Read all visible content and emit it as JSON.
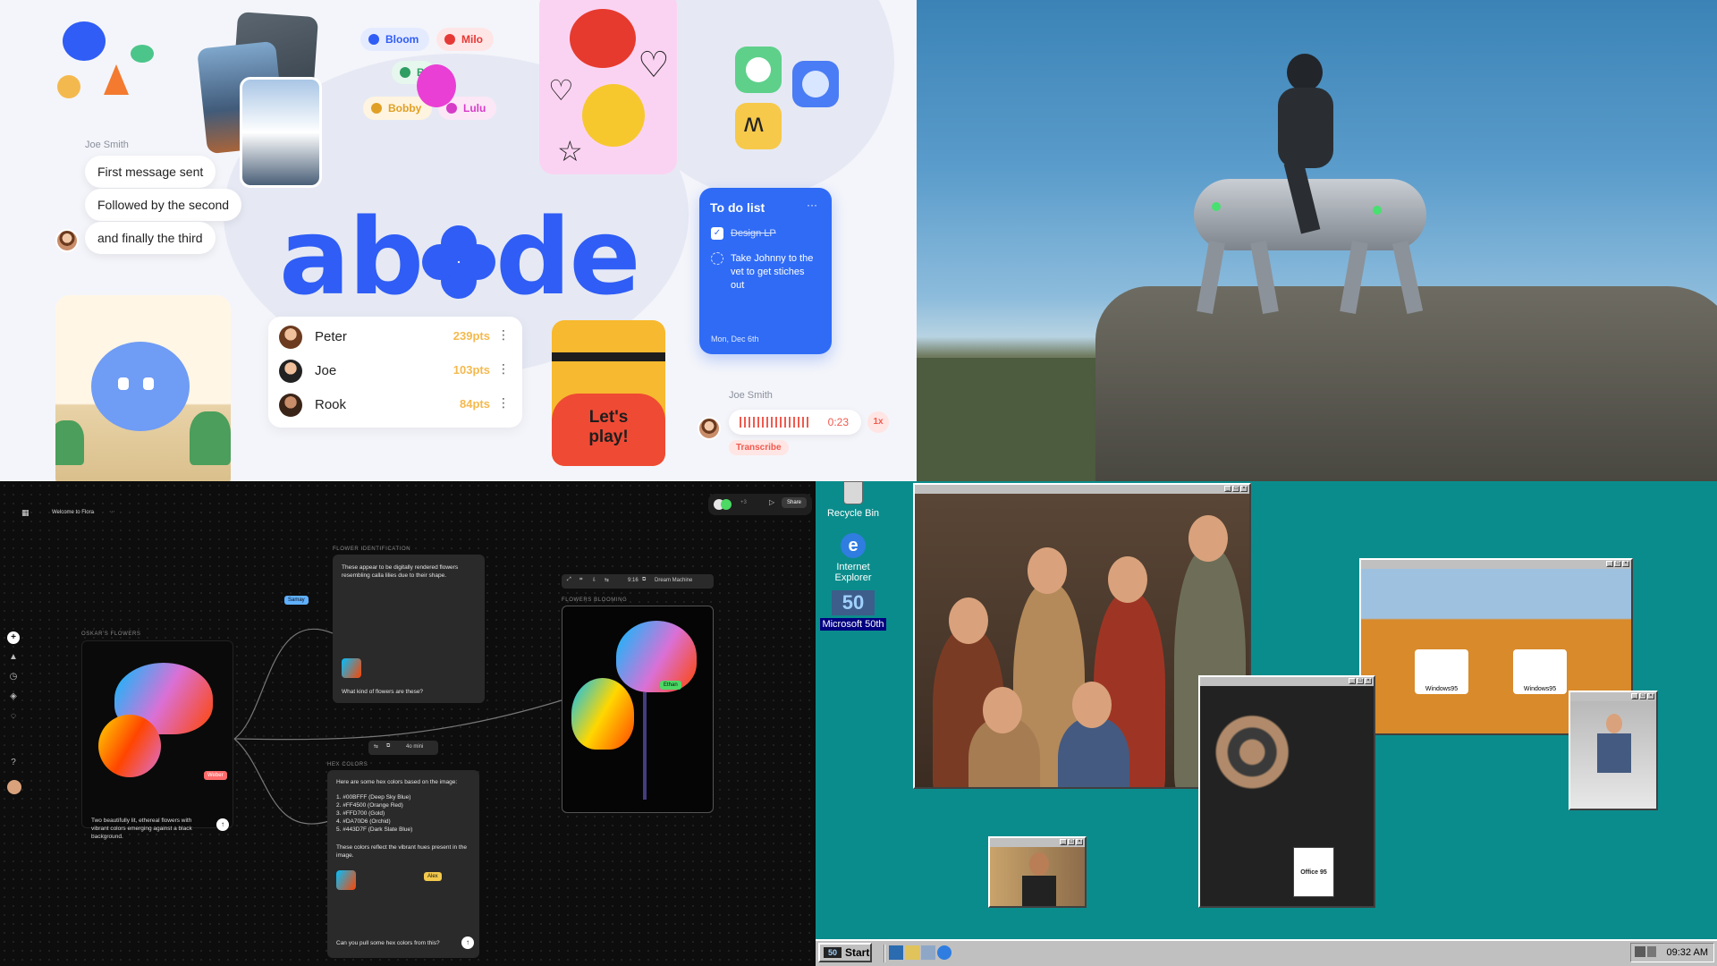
{
  "abode": {
    "logo": "abode",
    "chat": {
      "sender": "Joe Smith",
      "messages": [
        "First message sent",
        "Followed by the second",
        "and finally the third"
      ]
    },
    "tags": [
      "Bloom",
      "Milo",
      "B",
      "Bobby",
      "Lulu"
    ],
    "leaderboard": [
      {
        "name": "Peter",
        "points": "239pts"
      },
      {
        "name": "Joe",
        "points": "103pts"
      },
      {
        "name": "Rook",
        "points": "84pts"
      }
    ],
    "game_card": {
      "text_line1": "Let's",
      "text_line2": "play!"
    },
    "todo": {
      "title": "To do list",
      "menu": "···",
      "items": [
        {
          "text": "Design LP",
          "done": true
        },
        {
          "text": "Take Johnny to the vet to get stiches out",
          "done": false
        }
      ],
      "date": "Mon, Dec 6th"
    },
    "voice": {
      "sender": "Joe Smith",
      "duration": "0:23",
      "speed": "1x",
      "transcribe": "Transcribe"
    },
    "colors": {
      "brand": "#2f5df5",
      "points": "#f4b94e",
      "voice": "#f05a4f"
    }
  },
  "flora": {
    "window_title": "Welcome to Flora",
    "share_label": "Share",
    "avatar_count": "+3",
    "nodes": {
      "left_label": "OSKAR'S FLOWERS",
      "left_caption": "Two beautifully lit, ethereal flowers with vibrant colors emerging against a black background.",
      "ident_label": "FLOWER IDENTIFICATION",
      "ident_text": "These appear to be digitally rendered flowers resembling calla lilies due to their shape.",
      "ident_prompt": "What kind of flowers are these?",
      "hex_label": "HEX COLORS",
      "hex_intro": "Here are some hex colors based on the image:",
      "hex_list": [
        "1. #00BFFF (Deep Sky Blue)",
        "2. #FF4500 (Orange Red)",
        "3. #FFD700 (Gold)",
        "4. #DA70D6 (Orchid)",
        "5. #443D7F (Dark Slate Blue)"
      ],
      "hex_outro": "These colors reflect the vibrant hues present in the image.",
      "hex_prompt": "Can you pull some hex colors from this?",
      "model_chip": "4o mini",
      "right_label": "FLOWERS BLOOMING",
      "right_toolbar_ratio": "9:16",
      "right_toolbar_model": "Dream Machine"
    },
    "cursors": [
      {
        "name": "Samay",
        "color": "#5fb0ff"
      },
      {
        "name": "Weber",
        "color": "#ff6b6b"
      },
      {
        "name": "Alex",
        "color": "#f2c94c"
      },
      {
        "name": "Ethan",
        "color": "#4cd964"
      }
    ]
  },
  "win95": {
    "desktop_icons": [
      {
        "label": "Recycle Bin",
        "icon": "recycle-bin-icon"
      },
      {
        "label": "Internet Explorer",
        "icon": "internet-explorer-icon"
      },
      {
        "label": "Microsoft 50th",
        "icon": "microsoft-50th-icon",
        "selected": true
      }
    ],
    "start_label": "Start",
    "clock": "09:32 AM",
    "photo_labels": {
      "shirt_text": "Windows95",
      "box_text": "Office 95"
    },
    "colors": {
      "desktop": "#0b8c8c",
      "chrome": "#c0c0c0",
      "selection": "#000080"
    }
  }
}
